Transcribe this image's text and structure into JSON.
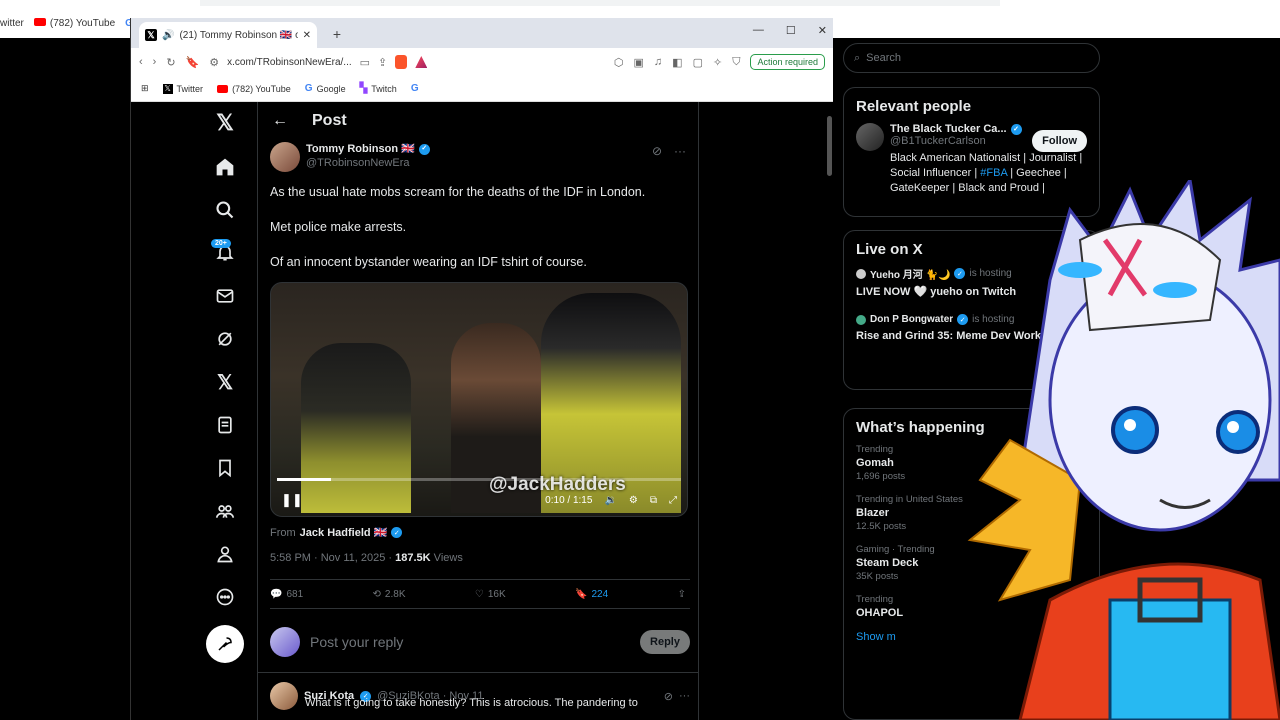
{
  "bg": {
    "bookmarks": [
      "witter",
      "(782) YouTube",
      "G"
    ]
  },
  "window": {
    "tab_title": "(21) Tommy Robinson 🇬🇧 on X",
    "new_tab": "+",
    "url": "x.com/TRobinsonNewEra/...",
    "action_required": "Action required",
    "bookmarks": [
      {
        "label": "Twitter",
        "icon": "x-icon"
      },
      {
        "label": "(782) YouTube",
        "icon": "youtube-icon"
      },
      {
        "label": "Google",
        "icon": "google-icon"
      },
      {
        "label": "Twitch",
        "icon": "twitch-icon"
      },
      {
        "label": "",
        "icon": "google-icon"
      }
    ]
  },
  "nav": {
    "badge": "20+"
  },
  "post": {
    "header_title": "Post",
    "author_name": "Tommy Robinson 🇬🇧",
    "author_handle": "@TRobinsonNewEra",
    "text_1": "As the usual hate mobs scream for the deaths of the IDF in London.",
    "text_2": "Met police make arrests.",
    "text_3": "Of an innocent bystander wearing an IDF tshirt of course.",
    "video": {
      "watermark": "@JackHadders",
      "time": "0:10 / 1:15",
      "progress": 0.133
    },
    "from_label": "From",
    "from_name": "Jack Hadfield 🇬🇧",
    "timestamp": "5:58 PM · Nov 11, 2025 · ",
    "views_count": "187.5K",
    "views_label": " Views",
    "stats": {
      "replies": "681",
      "reposts": "2.8K",
      "likes": "16K",
      "bookmarks": "224"
    },
    "reply_placeholder": "Post your reply",
    "reply_button": "Reply"
  },
  "reply": {
    "name": "Suzi Kota",
    "handle": "@SuziBKota · Nov 11",
    "text": "What is it going to take honestly? This is atrocious. The pandering to"
  },
  "right": {
    "search_placeholder": "Search",
    "relevant_title": "Relevant people",
    "rp_name": "The Black Tucker Ca...",
    "rp_handle": "@B1TuckerCarlson",
    "follow": "Follow",
    "rp_bio_1": "Black American Nationalist | Journalist | Social Influencer | ",
    "rp_bio_tag": "#FBA",
    "rp_bio_2": " | Geechee | GateKeeper | Black and Proud |",
    "live_title": "Live on X",
    "live": [
      {
        "host": "Yueho 月河 🐈🌙",
        "status": "is hosting",
        "title": "LIVE NOW 🤍 yueho on Twitch"
      },
      {
        "host": "Don P Bongwater",
        "status": "is hosting",
        "title": "Rise and Grind 35: Meme Dev Work"
      }
    ],
    "happening_title": "What’s happening",
    "trends": [
      {
        "ctx": "Trending",
        "name": "Gomah",
        "posts": "1,696 posts"
      },
      {
        "ctx": "Trending in United States",
        "name": "Blazer",
        "posts": "12.5K posts"
      },
      {
        "ctx": "Gaming · Trending",
        "name": "Steam Deck",
        "posts": "35K posts"
      },
      {
        "ctx": "Trending",
        "name": "OHAPOL",
        "posts": ""
      }
    ],
    "show_more": "Show m"
  },
  "colors": {
    "accent": "#1d9bf0",
    "background": "#000000",
    "text": "#e7e9ea",
    "muted": "#71767b"
  }
}
